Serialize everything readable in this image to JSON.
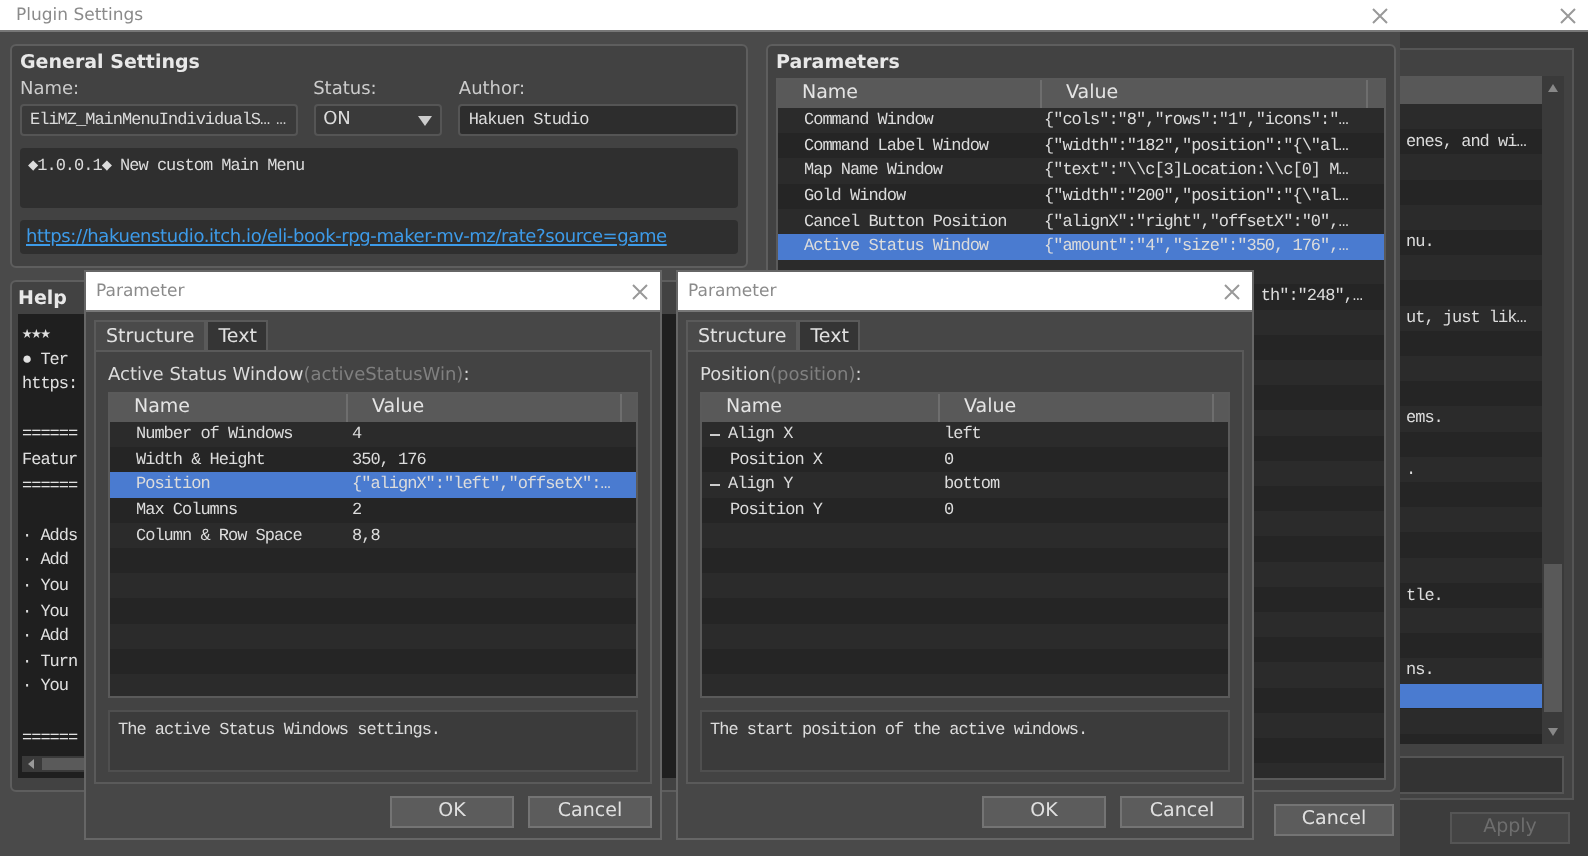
{
  "back_window": {
    "rows": [
      {
        "selected": false
      },
      {
        "text": "enes, and wi…",
        "selected": false
      },
      {
        "selected": false
      },
      {
        "selected": false
      },
      {
        "selected": false
      },
      {
        "text": "nu.",
        "selected": false
      },
      {
        "selected": false
      },
      {
        "selected": false
      },
      {
        "text": "ut, just lik…",
        "selected": false
      },
      {
        "selected": false
      },
      {
        "selected": false
      },
      {
        "selected": false
      },
      {
        "text": "ems.",
        "selected": false
      },
      {
        "selected": false
      },
      {
        "text": ".",
        "selected": false
      },
      {
        "selected": false
      },
      {
        "selected": false
      },
      {
        "selected": false
      },
      {
        "selected": false
      },
      {
        "text": "tle.",
        "selected": false
      },
      {
        "selected": false
      },
      {
        "selected": false
      },
      {
        "text": "ns.",
        "selected": false
      },
      {
        "selected": true
      }
    ],
    "buttons": [
      {
        "label": "Apply",
        "disabled": true
      }
    ]
  },
  "plugin_settings": {
    "title": "Plugin Settings",
    "general_settings": {
      "heading": "General Settings",
      "name_label": "Name:",
      "name": "EliMZ_MainMenuIndividualS…",
      "browse": "…",
      "status_label": "Status:",
      "status": "ON",
      "author_label": "Author:",
      "author": "Hakuen Studio",
      "description": "◆1.0.0.1◆ New custom Main Menu",
      "url": "https://hakuenstudio.itch.io/eli-book-rpg-maker-mv-mz/rate?source=game"
    },
    "parameters": {
      "heading": "Parameters",
      "columns": [
        "Name",
        "Value"
      ],
      "rows": [
        {
          "name": "Command Window",
          "value": "{\"cols\":\"8\",\"rows\":\"1\",\"icons\":\"…",
          "selected": false
        },
        {
          "name": "Command Label Window",
          "value": "{\"width\":\"182\",\"position\":\"{\\\"al…",
          "selected": false
        },
        {
          "name": "Map Name Window",
          "value": "{\"text\":\"\\\\c[3]Location:\\\\c[0] M…",
          "selected": false
        },
        {
          "name": "Gold Window",
          "value": "{\"width\":\"200\",\"position\":\"{\\\"al…",
          "selected": false
        },
        {
          "name": "Cancel Button Position",
          "value": "{\"alignX\":\"right\",\"offsetX\":\"0\",…",
          "selected": false
        },
        {
          "name": "Active Status Window",
          "value": "{\"amount\":\"4\",\"size\":\"350, 176\",…",
          "selected": true
        },
        {
          "kind": "covered"
        },
        {
          "value": "th\":\"248\",…",
          "selected": false,
          "kind": "partial"
        }
      ]
    },
    "help": {
      "heading": "Help",
      "lines": [
        {
          "kind": "text",
          "text": "★★★"
        },
        {
          "kind": "text",
          "text": "● Ter"
        },
        {
          "kind": "text",
          "text": "https:"
        },
        {
          "kind": "blank"
        },
        {
          "kind": "text",
          "text": "======"
        },
        {
          "kind": "text",
          "text": "Featur"
        },
        {
          "kind": "text",
          "text": "======"
        },
        {
          "kind": "blank"
        },
        {
          "kind": "text",
          "text": "· Adds"
        },
        {
          "kind": "text",
          "text": "· Add"
        },
        {
          "kind": "text",
          "text": "· You"
        },
        {
          "kind": "text",
          "text": "· You"
        },
        {
          "kind": "text",
          "text": "· Add"
        },
        {
          "kind": "text",
          "text": "· Turn"
        },
        {
          "kind": "text",
          "text": "· You"
        },
        {
          "kind": "blank"
        },
        {
          "kind": "text",
          "text": "======"
        }
      ]
    },
    "buttons": [
      {
        "label": "Cancel"
      }
    ]
  },
  "parameter_dialogs": [
    {
      "title": "Parameter",
      "tabs": [
        {
          "label": "Structure",
          "selected": true
        },
        {
          "label": "Text",
          "selected": false
        }
      ],
      "label": "Active Status Window",
      "key": "(activeStatusWin)",
      "suffix": ":",
      "columns": [
        "Name",
        "Value"
      ],
      "rows": [
        {
          "name": "Number of Windows",
          "value": "4",
          "selected": false
        },
        {
          "name": "Width & Height",
          "value": "350, 176",
          "selected": false
        },
        {
          "name": "Position",
          "value": "{\"alignX\":\"left\",\"offsetX\":…",
          "selected": true
        },
        {
          "name": "Max Columns",
          "value": "2",
          "selected": false
        },
        {
          "name": "Column & Row Space",
          "value": "8,8",
          "selected": false
        }
      ],
      "description": "The active Status Windows settings.",
      "buttons": [
        "OK",
        "Cancel"
      ]
    },
    {
      "title": "Parameter",
      "tabs": [
        {
          "label": "Structure",
          "selected": true
        },
        {
          "label": "Text",
          "selected": false
        }
      ],
      "label": "Position",
      "key": "(position)",
      "suffix": ":",
      "columns": [
        "Name",
        "Value"
      ],
      "rows": [
        {
          "name": "Align X",
          "value": "left",
          "selected": false,
          "expanded": true,
          "children": [
            {
              "name": "Position X",
              "value": "0",
              "selected": false
            }
          ]
        },
        {
          "name": "Align Y",
          "value": "bottom",
          "selected": false,
          "expanded": true,
          "children": [
            {
              "name": "Position Y",
              "value": "0",
              "selected": false
            }
          ]
        }
      ],
      "description": "The start position of the active windows.",
      "buttons": [
        "OK",
        "Cancel"
      ]
    }
  ]
}
